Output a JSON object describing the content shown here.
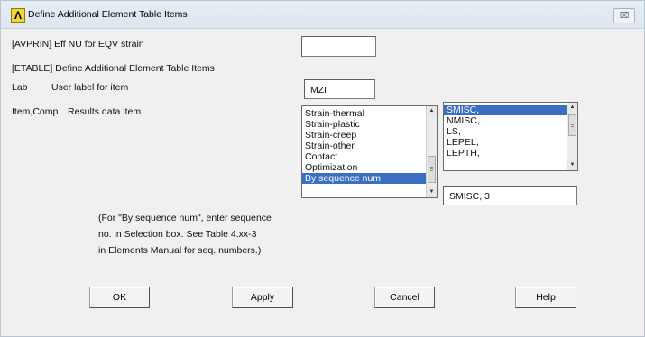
{
  "window": {
    "title": "Define Additional Element Table Items",
    "close_glyph": "⌧"
  },
  "fields": {
    "avprin_label": "[AVPRIN] Eff NU for EQV strain",
    "avprin_value": "",
    "etable_label": "[ETABLE] Define Additional Element Table Items",
    "lab_key": "Lab",
    "lab_desc": "User label for item",
    "lab_value": "MZI",
    "item_key": "Item,Comp",
    "item_desc": "Results data item"
  },
  "category_list": {
    "items": [
      "Strain-thermal",
      "Strain-plastic",
      "Strain-creep",
      "Strain-other",
      "Contact",
      "Optimization",
      "By sequence num"
    ],
    "selected_index": 6
  },
  "component_list": {
    "items": [
      "SMISC,",
      "NMISC,",
      "LS,",
      "LEPEL,",
      "LEPTH,"
    ],
    "selected_index": 0
  },
  "selection": {
    "value": "SMISC, 3"
  },
  "note": {
    "line1": "(For \"By sequence num\", enter sequence",
    "line2": "no. in Selection box.  See Table 4.xx-3",
    "line3": "in Elements Manual for seq. numbers.)"
  },
  "buttons": {
    "ok": "OK",
    "apply": "Apply",
    "cancel": "Cancel",
    "help": "Help"
  }
}
